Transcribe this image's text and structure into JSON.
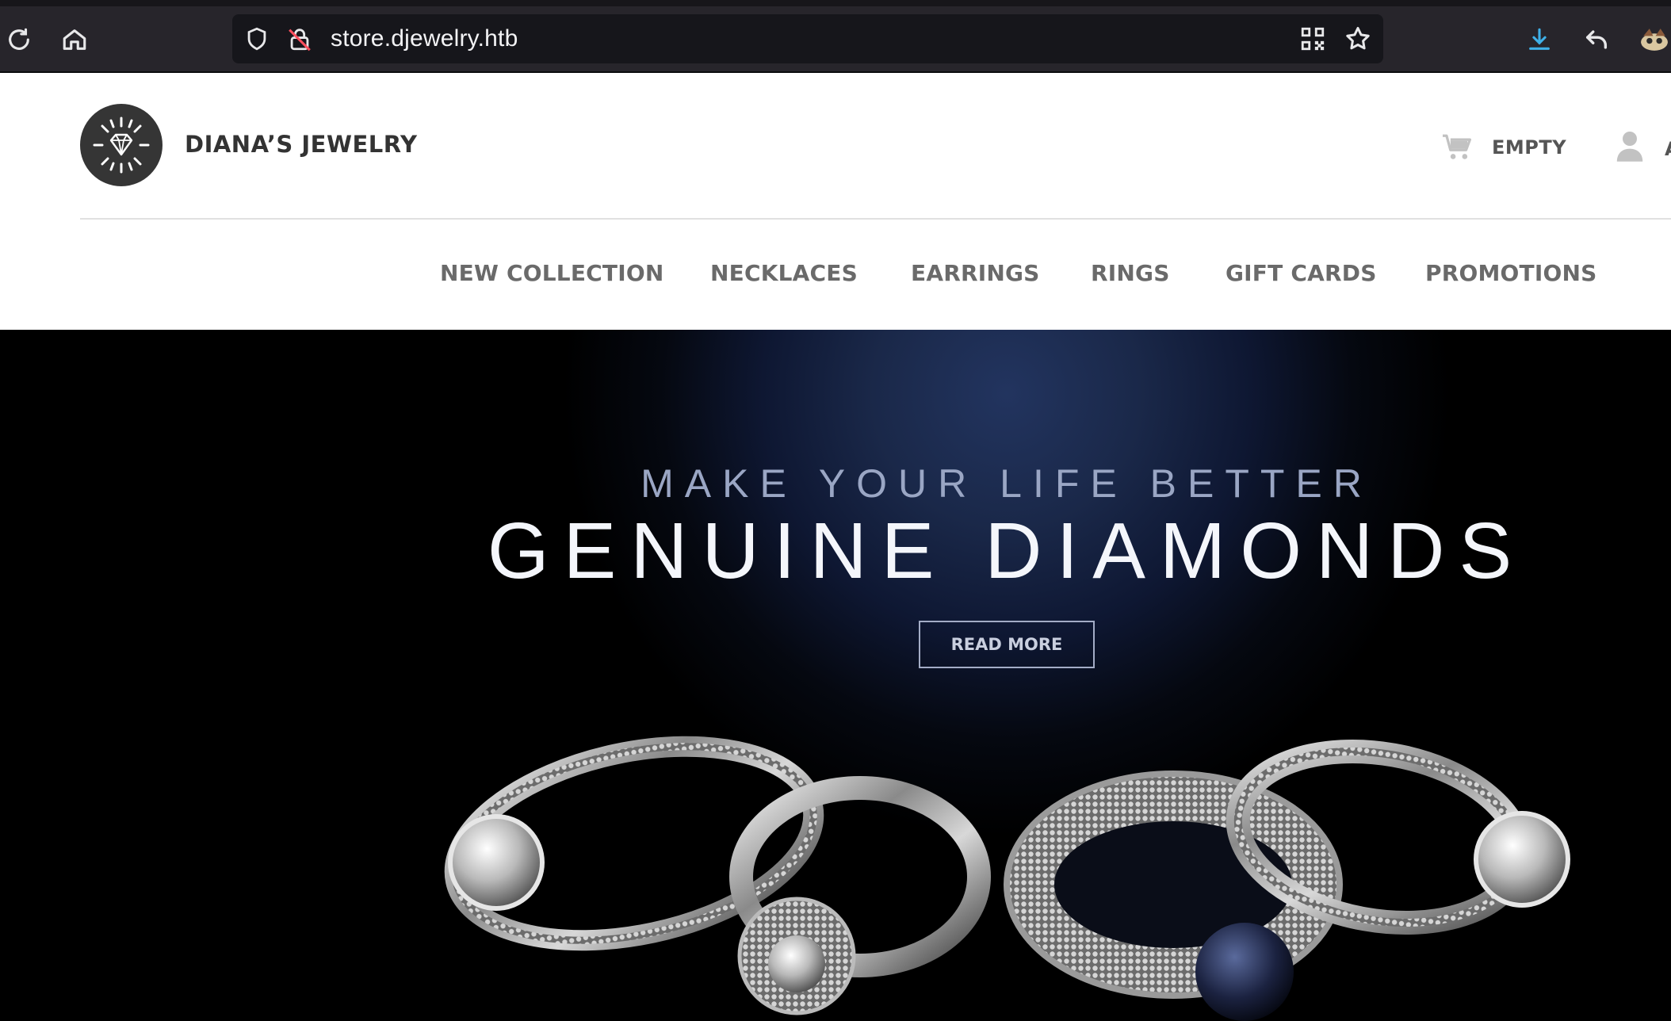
{
  "browser": {
    "url": "store.djewelry.htb",
    "icons": [
      "reload-icon",
      "home-icon",
      "shield-icon",
      "insecure-lock-icon",
      "qr-code-icon",
      "bookmark-star-icon",
      "download-icon",
      "back-arrow-icon",
      "extension-icon"
    ]
  },
  "site": {
    "brand": "DIANA’S JEWELRY",
    "cart_label": "EMPTY",
    "account_label": "A",
    "nav": [
      "NEW COLLECTION",
      "NECKLACES",
      "EARRINGS",
      "RINGS",
      "GIFT CARDS",
      "PROMOTIONS"
    ]
  },
  "hero": {
    "subtitle": "MAKE YOUR LIFE BETTER",
    "title": "GENUINE DIAMONDS",
    "cta": "READ MORE"
  },
  "colors": {
    "chrome_bg": "#27252b",
    "urlbar_bg": "#16161b",
    "logo_bg": "#353535",
    "nav_text": "#6a6a6a",
    "hero_glow": "#22345f",
    "download_accent": "#3fb0e8"
  }
}
